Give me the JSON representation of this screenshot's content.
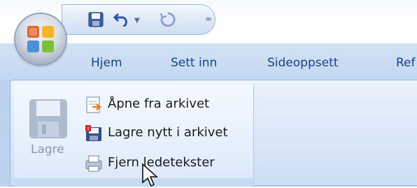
{
  "quick_access": {
    "save_icon": "save-icon",
    "undo_icon": "undo-icon",
    "redo_icon": "redo-icon",
    "more_glyph": "="
  },
  "tabs": [
    {
      "label": "Hjem"
    },
    {
      "label": "Sett inn"
    },
    {
      "label": "Sideoppsett"
    },
    {
      "label": "Ref"
    }
  ],
  "group": {
    "large_button_label": "Lagre",
    "items": [
      {
        "label": "Åpne fra arkivet",
        "icon": "open-from-archive-icon"
      },
      {
        "label": "Lagre nytt i arkivet",
        "icon": "save-new-archive-icon"
      },
      {
        "label": "Fjern ledetekster",
        "icon": "remove-prompts-icon"
      }
    ]
  },
  "colors": {
    "tab_text": "#15428b",
    "ribbon_bg": "#dde9f8"
  }
}
